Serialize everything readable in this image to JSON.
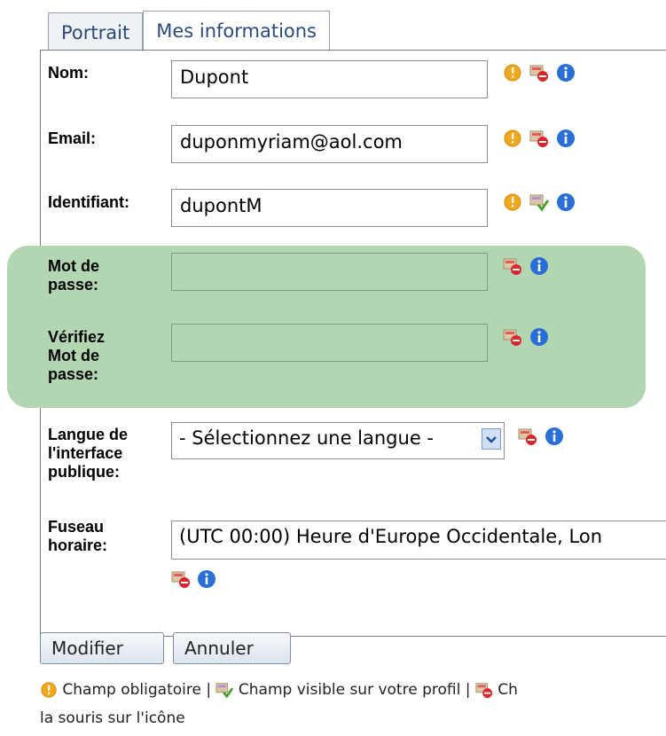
{
  "tabs": [
    {
      "label": "Portrait"
    },
    {
      "label": "Mes informations"
    }
  ],
  "form": {
    "nom": {
      "label": "Nom:",
      "value": "Dupont"
    },
    "email": {
      "label": "Email:",
      "value": "duponmyriam@aol.com"
    },
    "identifiant": {
      "label": "Identifiant:",
      "value": "dupontM"
    },
    "password": {
      "label": "Mot de\npasse:",
      "value": ""
    },
    "password_verify": {
      "label": "Vérifiez\nMot de\npasse:",
      "value": ""
    },
    "langue": {
      "label": "Langue de\nl'interface\npublique:",
      "selected": "- Sélectionnez une langue -"
    },
    "fuseau": {
      "label": "Fuseau\nhoraire:",
      "selected": "(UTC 00:00) Heure d'Europe Occidentale, Lon"
    }
  },
  "buttons": {
    "modifier": "Modifier",
    "annuler": "Annuler"
  },
  "legend": {
    "required": "Champ obligatoire |",
    "visible": "Champ visible sur votre profil |",
    "hidden_prefix": "Ch",
    "line2": "la souris sur l'icône"
  },
  "colors": {
    "highlight": "#b3d6b2",
    "tab_text": "#2b4a78",
    "info_blue": "#2a6fd6",
    "required_orange": "#f2a81c"
  },
  "icons": [
    "warning-icon",
    "hidden-profile-icon",
    "visible-profile-icon",
    "info-icon"
  ]
}
